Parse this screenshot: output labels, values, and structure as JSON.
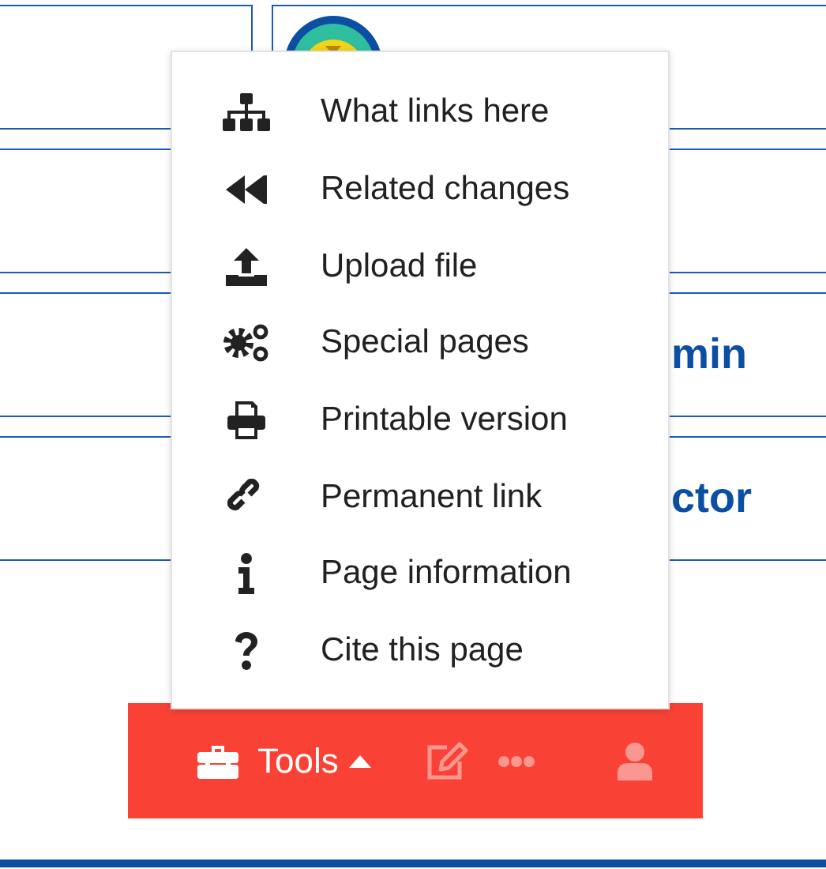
{
  "background": {
    "rows": [
      {
        "text": "min"
      },
      {
        "text": "ctor"
      }
    ]
  },
  "tools_menu": {
    "items": [
      {
        "label": "What links here"
      },
      {
        "label": "Related changes"
      },
      {
        "label": "Upload file"
      },
      {
        "label": "Special pages"
      },
      {
        "label": "Printable version"
      },
      {
        "label": "Permanent link"
      },
      {
        "label": "Page information"
      },
      {
        "label": "Cite this page"
      }
    ]
  },
  "toolbar": {
    "tools": {
      "label": "Tools",
      "expanded": true
    },
    "buttons": [
      {
        "kind": "edit",
        "disabled": true
      },
      {
        "kind": "more",
        "disabled": true
      },
      {
        "kind": "user",
        "disabled": true
      }
    ]
  }
}
